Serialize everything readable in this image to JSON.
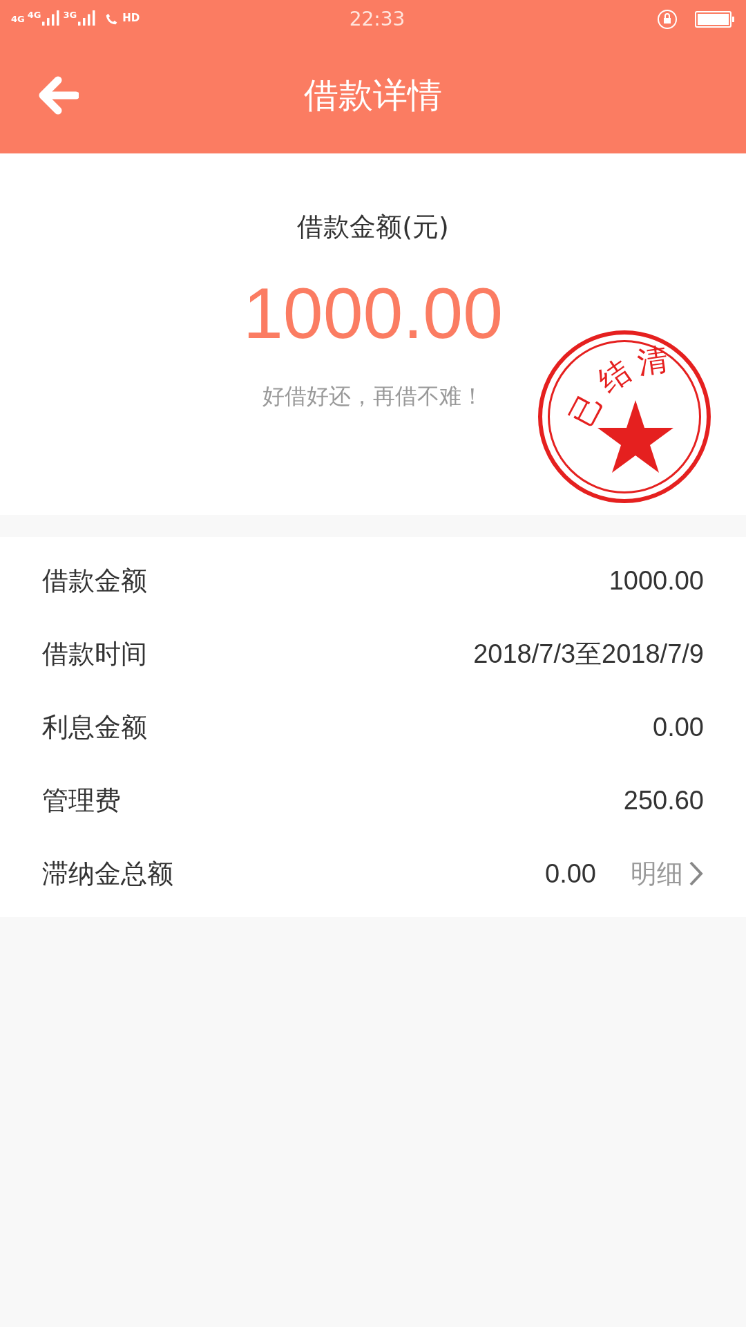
{
  "status_bar": {
    "network_labels": [
      "4G",
      "4G",
      "3G"
    ],
    "call_label": "HD",
    "time": "22:33"
  },
  "header": {
    "title": "借款详情"
  },
  "summary": {
    "label": "借款金额(元)",
    "amount": "1000.00",
    "slogan": "好借好还，再借不难！",
    "stamp": {
      "text": "已结清"
    }
  },
  "details": [
    {
      "label": "借款金额",
      "value": "1000.00"
    },
    {
      "label": "借款时间",
      "value": "2018/7/3至2018/7/9"
    },
    {
      "label": "利息金额",
      "value": "0.00"
    },
    {
      "label": "管理费",
      "value": "250.60"
    },
    {
      "label": "滞纳金总额",
      "value": "0.00",
      "link": "明细"
    }
  ]
}
